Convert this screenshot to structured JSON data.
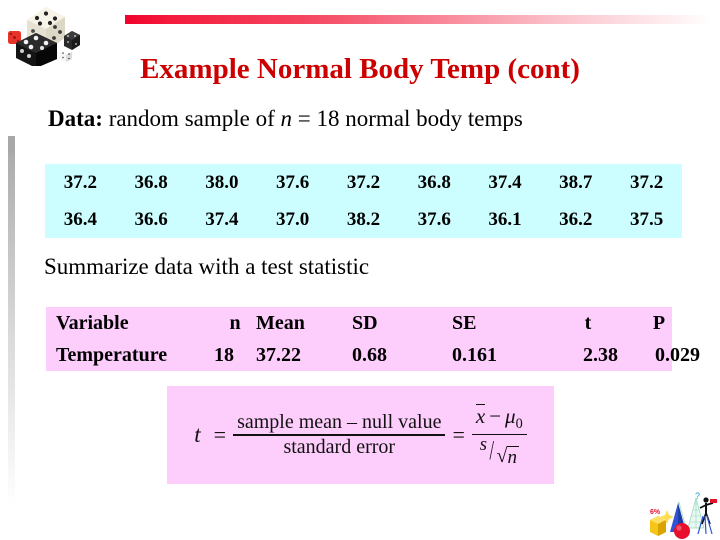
{
  "slide": {
    "title": "Example Normal Body Temp (cont)",
    "title_color": "#cc0000",
    "background": "#ffffff"
  },
  "decorations": {
    "top_bar": {
      "name": "red-gradient-bar",
      "color": "#f0022b"
    },
    "left_bar": {
      "name": "gray-gradient-bar",
      "color": "#a8a8a8"
    },
    "dice_clipart": "dice-clipart",
    "shapes_clipart": "geometric-shapes-clipart"
  },
  "body": {
    "data_label": "Data:",
    "data_text_before": "random sample of",
    "data_italic_var": "n",
    "data_equals": "= 18",
    "data_text_after": "normal body temps",
    "data_line_full": "Data: random sample of n = 18 normal body temps",
    "summarize_text": "Summarize data with a test statistic"
  },
  "data_table": {
    "background": "#ccfdff",
    "rows": [
      [
        "37.2",
        "36.8",
        "38.0",
        "37.6",
        "37.2",
        "36.8",
        "37.4",
        "38.7",
        "37.2"
      ],
      [
        "36.4",
        "36.6",
        "37.4",
        "37.0",
        "38.2",
        "37.6",
        "36.1",
        "36.2",
        "37.5"
      ]
    ]
  },
  "stats_table": {
    "background": "#fdcdfc",
    "headers": [
      "Variable",
      "n",
      "Mean",
      "SD",
      "SE",
      "t",
      "P"
    ],
    "values": [
      "Temperature",
      "18",
      "37.22",
      "0.68",
      "0.161",
      "2.38",
      "0.029"
    ]
  },
  "formula": {
    "background": "#fdcdfc",
    "lhs": "t",
    "equals": "=",
    "numerator_words": "sample mean – null value",
    "denominator_words": "standard error",
    "equals2": "=",
    "numerator_symbols": "x̄ − μ0",
    "num_sym_x": "x",
    "num_sym_minus": "−",
    "num_sym_mu": "μ",
    "num_sym_mu_sub": "0",
    "denominator_symbols": "s/√n",
    "den_sym_s": "s",
    "den_sym_slash": "/",
    "den_sym_radical": "√",
    "den_sym_n": "n",
    "plain_text": "t = (sample mean – null value) / standard error = (x̄ − μ0) / (s/√n)"
  },
  "chart_data": {
    "type": "table",
    "title": "Example Normal Body Temp (cont)",
    "description": "Random sample of n = 18 normal body temperatures with one-sample t-test summary",
    "sample_size": 18,
    "observations": [
      37.2,
      36.8,
      38.0,
      37.6,
      37.2,
      36.8,
      37.4,
      38.7,
      37.2,
      36.4,
      36.6,
      37.4,
      37.0,
      38.2,
      37.6,
      36.1,
      36.2,
      37.5
    ],
    "summary_columns": [
      "Variable",
      "n",
      "Mean",
      "SD",
      "SE",
      "t",
      "P"
    ],
    "summary_values": [
      "Temperature",
      18,
      37.22,
      0.68,
      0.161,
      2.38,
      0.029
    ]
  }
}
